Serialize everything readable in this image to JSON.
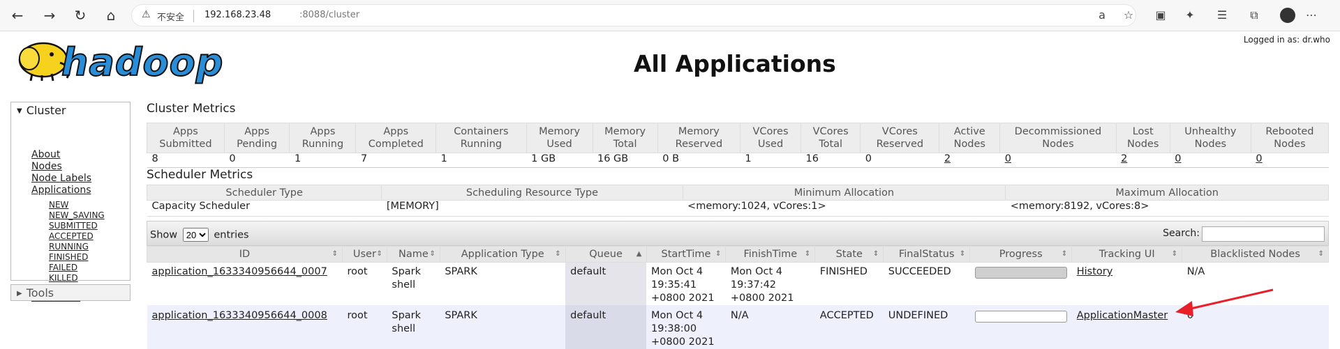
{
  "browser": {
    "insecure_label": "不安全",
    "host": "192.168.23.48",
    "path": ":8088/cluster"
  },
  "header": {
    "logo_text": "hadoop",
    "title": "All Applications",
    "logged_in": "Logged in as: dr.who"
  },
  "sidebar": {
    "cluster_label": "Cluster",
    "items": [
      "About",
      "Nodes",
      "Node Labels",
      "Applications"
    ],
    "app_states": [
      "NEW",
      "NEW_SAVING",
      "SUBMITTED",
      "ACCEPTED",
      "RUNNING",
      "FINISHED",
      "FAILED",
      "KILLED"
    ],
    "scheduler": "Scheduler",
    "tools_label": "Tools"
  },
  "cluster_metrics": {
    "title": "Cluster Metrics",
    "headers": [
      "Apps Submitted",
      "Apps Pending",
      "Apps Running",
      "Apps Completed",
      "Containers Running",
      "Memory Used",
      "Memory Total",
      "Memory Reserved",
      "VCores Used",
      "VCores Total",
      "VCores Reserved",
      "Active Nodes",
      "Decommissioned Nodes",
      "Lost Nodes",
      "Unhealthy Nodes",
      "Rebooted Nodes"
    ],
    "values": [
      "8",
      "0",
      "1",
      "7",
      "1",
      "1 GB",
      "16 GB",
      "0 B",
      "1",
      "16",
      "0",
      "2",
      "0",
      "2",
      "0",
      "0"
    ]
  },
  "scheduler_metrics": {
    "title": "Scheduler Metrics",
    "headers": [
      "Scheduler Type",
      "Scheduling Resource Type",
      "Minimum Allocation",
      "Maximum Allocation"
    ],
    "values": [
      "Capacity Scheduler",
      "[MEMORY]",
      "<memory:1024, vCores:1>",
      "<memory:8192, vCores:8>"
    ]
  },
  "apps_table": {
    "show_label": "Show",
    "entries_value": "20",
    "entries_label": "entries",
    "search_label": "Search:",
    "headers": [
      "ID",
      "User",
      "Name",
      "Application Type",
      "Queue",
      "StartTime",
      "FinishTime",
      "State",
      "FinalStatus",
      "Progress",
      "Tracking UI",
      "Blacklisted Nodes"
    ],
    "rows": [
      {
        "id": "application_1633340956644_0007",
        "user": "root",
        "name": "Spark shell",
        "type": "SPARK",
        "queue": "default",
        "start": "Mon Oct 4 19:35:41 +0800 2021",
        "finish": "Mon Oct 4 19:37:42 +0800 2021",
        "state": "FINISHED",
        "final_status": "SUCCEEDED",
        "progress": 1.0,
        "tracking": "History",
        "blacklisted": "N/A"
      },
      {
        "id": "application_1633340956644_0008",
        "user": "root",
        "name": "Spark shell",
        "type": "SPARK",
        "queue": "default",
        "start": "Mon Oct 4 19:38:00 +0800 2021",
        "finish": "N/A",
        "state": "ACCEPTED",
        "final_status": "UNDEFINED",
        "progress": 0.0,
        "tracking": "ApplicationMaster",
        "blacklisted": "0"
      }
    ]
  },
  "colors": {
    "progress_fill": "#cfcfcf",
    "annotation_arrow": "#e8202a"
  }
}
